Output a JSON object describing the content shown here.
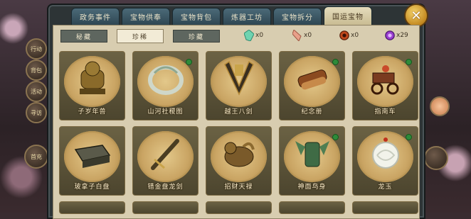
{
  "tabs": [
    "政务事件",
    "宝物供奉",
    "宝物背包",
    "炼器工坊",
    "宝物拆分",
    "国运宝物"
  ],
  "active_tab": 5,
  "subtabs": [
    "秘藏",
    "珍稀",
    "珍藏"
  ],
  "active_subtab": 1,
  "resources": [
    {
      "icon": "green-crystal-icon",
      "count": "x0",
      "color": "#6fd3b0"
    },
    {
      "icon": "pink-crystal-icon",
      "count": "x0",
      "color": "#e8a08a"
    },
    {
      "icon": "red-seal-icon",
      "count": "x0",
      "color": "#c0481c"
    },
    {
      "icon": "purple-lotus-icon",
      "count": "x29",
      "color": "#9b3fd0"
    }
  ],
  "items": [
    {
      "name": "子岁年兽",
      "icon": "bronze-beast-icon",
      "color": "#8a6a2a"
    },
    {
      "name": "山河社稷图",
      "icon": "jade-ring-icon",
      "color": "#cfd7c9"
    },
    {
      "name": "越王八剑",
      "icon": "sword-bundle-icon",
      "color": "#3a2f1f"
    },
    {
      "name": "纪念册",
      "icon": "scroll-bundle-icon",
      "color": "#8b4a20"
    },
    {
      "name": "指南车",
      "icon": "chariot-icon",
      "color": "#7a3b20"
    },
    {
      "name": "玻拿子白盘",
      "icon": "stone-box-icon",
      "color": "#5a5a4a"
    },
    {
      "name": "错金盘龙剑",
      "icon": "gold-dagger-icon",
      "color": "#4a3d22"
    },
    {
      "name": "招财天禄",
      "icon": "golden-beast-icon",
      "color": "#7a5a2a"
    },
    {
      "name": "神面鸟身",
      "icon": "bronze-bird-icon",
      "color": "#3f6b45"
    },
    {
      "name": "龙玉",
      "icon": "white-jade-dragon-icon",
      "color": "#f2f3ea"
    }
  ],
  "item_dot_flags": [
    false,
    true,
    false,
    true,
    true,
    false,
    false,
    false,
    true,
    true
  ],
  "side_buttons": [
    "行动",
    "背包",
    "活动",
    "寻访",
    "首充"
  ]
}
